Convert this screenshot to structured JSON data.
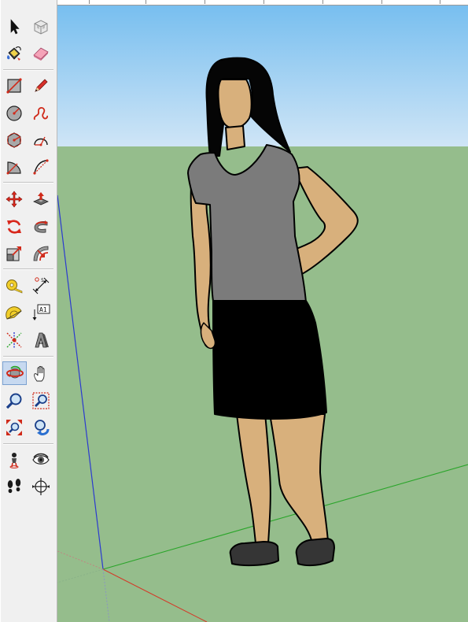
{
  "toolbar": {
    "tools": [
      {
        "name": "select-tool",
        "icon": "arrow-cursor-icon"
      },
      {
        "name": "make-component-tool",
        "icon": "component-box-icon"
      },
      {
        "name": "paint-bucket-tool",
        "icon": "paint-bucket-icon"
      },
      {
        "name": "eraser-tool",
        "icon": "eraser-icon"
      },
      {
        "name": "rectangle-tool",
        "icon": "rectangle-icon"
      },
      {
        "name": "line-tool",
        "icon": "pencil-icon"
      },
      {
        "name": "circle-tool",
        "icon": "circle-icon"
      },
      {
        "name": "freehand-tool",
        "icon": "freehand-curve-icon"
      },
      {
        "name": "polygon-tool",
        "icon": "polygon-icon"
      },
      {
        "name": "arc-tool",
        "icon": "arc-icon"
      },
      {
        "name": "pie-tool",
        "icon": "pie-icon"
      },
      {
        "name": "two-point-arc-tool",
        "icon": "two-point-arc-icon"
      },
      {
        "name": "move-tool",
        "icon": "move-arrows-icon"
      },
      {
        "name": "push-pull-tool",
        "icon": "push-pull-icon"
      },
      {
        "name": "rotate-tool",
        "icon": "rotate-icon"
      },
      {
        "name": "follow-me-tool",
        "icon": "follow-me-icon"
      },
      {
        "name": "scale-tool",
        "icon": "scale-icon"
      },
      {
        "name": "offset-tool",
        "icon": "offset-icon"
      },
      {
        "name": "tape-measure-tool",
        "icon": "tape-measure-icon"
      },
      {
        "name": "dimension-tool",
        "icon": "dimension-icon"
      },
      {
        "name": "protractor-tool",
        "icon": "protractor-icon"
      },
      {
        "name": "text-tool",
        "icon": "text-label-icon",
        "label": "A1"
      },
      {
        "name": "axes-tool",
        "icon": "axes-icon"
      },
      {
        "name": "3d-text-tool",
        "icon": "3d-text-icon"
      },
      {
        "name": "orbit-tool",
        "icon": "orbit-icon",
        "active": true
      },
      {
        "name": "pan-tool",
        "icon": "hand-icon"
      },
      {
        "name": "zoom-tool",
        "icon": "magnifier-icon"
      },
      {
        "name": "zoom-window-tool",
        "icon": "zoom-window-icon"
      },
      {
        "name": "zoom-extents-tool",
        "icon": "zoom-extents-icon"
      },
      {
        "name": "previous-view-tool",
        "icon": "previous-view-icon"
      },
      {
        "name": "position-camera-tool",
        "icon": "position-camera-icon"
      },
      {
        "name": "look-around-tool",
        "icon": "eye-icon"
      },
      {
        "name": "walk-tool",
        "icon": "footprints-icon"
      },
      {
        "name": "section-plane-tool",
        "icon": "section-plane-icon"
      }
    ]
  },
  "viewport": {
    "sky_color": "#a9d3f3",
    "ground_color": "#95bd8c",
    "axis_colors": {
      "red": "#d23c2a",
      "green": "#2aa52a",
      "blue": "#2b3ad0"
    },
    "model": {
      "name": "sketchup-person-figure",
      "shirt_color": "#7b7b7b",
      "skirt_color": "#000000",
      "skin_color": "#d8b07c",
      "hair_color": "#050505"
    }
  }
}
